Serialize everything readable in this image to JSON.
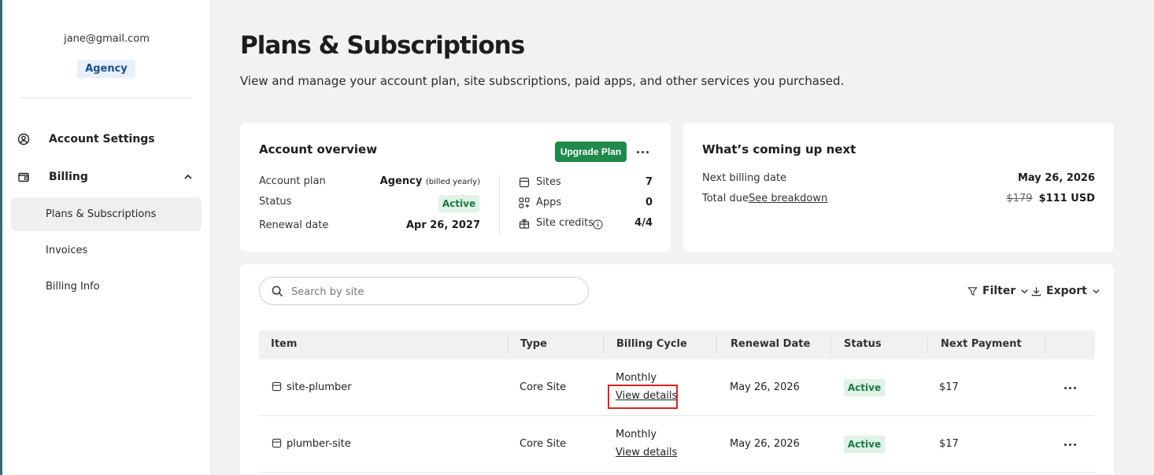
{
  "sidebar": {
    "email": "jane@gmail.com",
    "plan_badge": "Agency",
    "items": [
      {
        "label": "Account Settings",
        "icon": "user-circle-icon"
      },
      {
        "label": "Billing",
        "icon": "wallet-icon",
        "expanded": true
      }
    ],
    "billing_subitems": [
      {
        "label": "Plans & Subscriptions",
        "active": true
      },
      {
        "label": "Invoices",
        "active": false
      },
      {
        "label": "Billing Info",
        "active": false
      }
    ]
  },
  "header": {
    "title": "Plans & Subscriptions",
    "subtitle": "View and manage your account plan, site subscriptions, paid apps, and other services you purchased."
  },
  "account_overview": {
    "title": "Account overview",
    "upgrade_label": "Upgrade Plan",
    "rows": [
      {
        "label": "Account plan",
        "value": "Agency",
        "value_note": "(billed yearly)"
      },
      {
        "label": "Status",
        "value": "Active"
      },
      {
        "label": "Renewal date",
        "value": "Apr 26, 2027"
      }
    ],
    "stats": [
      {
        "label": "Sites",
        "value": "7",
        "icon": "database-icon"
      },
      {
        "label": "Apps",
        "value": "0",
        "icon": "apps-grid-icon"
      },
      {
        "label": "Site credits",
        "value": "4/4",
        "icon": "gift-icon"
      }
    ]
  },
  "coming_up": {
    "title": "What’s coming up next",
    "next_billing_label": "Next billing date",
    "next_billing_value": "May 26, 2026",
    "total_due_label": "Total due",
    "breakdown_link": "See breakdown",
    "old_price": "$179",
    "new_price": "$111 USD"
  },
  "toolbar": {
    "search_placeholder": "Search by site",
    "filter_label": "Filter",
    "export_label": "Export"
  },
  "table": {
    "columns": [
      "Item",
      "Type",
      "Billing Cycle",
      "Renewal Date",
      "Status",
      "Next Payment"
    ],
    "rows": [
      {
        "item": "site-plumber",
        "type": "Core Site",
        "cycle": "Monthly",
        "details_link": "View details",
        "renewal": "May 26, 2026",
        "status": "Active",
        "payment": "$17"
      },
      {
        "item": "plumber-site",
        "type": "Core Site",
        "cycle": "Monthly",
        "details_link": "View details",
        "renewal": "May 26, 2026",
        "status": "Active",
        "payment": "$17"
      }
    ]
  },
  "colors": {
    "accent_green": "#1f8a4a",
    "status_bg": "#dff3e6",
    "highlight_red": "#e02020"
  }
}
